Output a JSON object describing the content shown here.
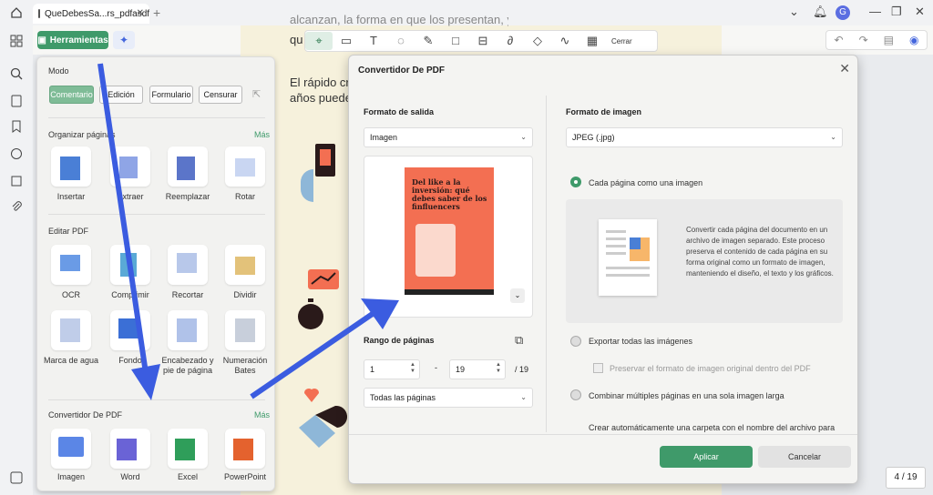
{
  "tab": {
    "title": "QueDebesSa...rs_pdfasdf"
  },
  "avatar_letter": "G",
  "toolbar": {
    "tools_label": "Herramientas",
    "close_label": "Cerrar"
  },
  "document": {
    "line0": "alcanzan, la forma en que los presentan, y la influencia (positiva o negativa)",
    "line1": "qu",
    "line2a": "El rápido cre",
    "line2b": "años puede"
  },
  "page_counter": "4 / 19",
  "tools_panel": {
    "mode_label": "Modo",
    "modes": [
      "Comentario",
      "Edición",
      "Formulario",
      "Censurar"
    ],
    "organize_label": "Organizar páginas",
    "more_label": "Más",
    "organize_items": [
      "Insertar",
      "Extraer",
      "Reemplazar",
      "Rotar"
    ],
    "edit_label": "Editar PDF",
    "edit_items": [
      "OCR",
      "Comprimir",
      "Recortar",
      "Dividir",
      "Marca de agua",
      "Fondo",
      "Encabezado y pie de página",
      "Numeración Bates"
    ],
    "convert_label": "Convertidor De PDF",
    "convert_items": [
      "Imagen",
      "Word",
      "Excel",
      "PowerPoint"
    ]
  },
  "dialog": {
    "title": "Convertidor De PDF",
    "output_format_label": "Formato de salida",
    "output_format_value": "Imagen",
    "image_format_label": "Formato de imagen",
    "image_format_value": "JPEG (.jpg)",
    "cover_title": "Del like a la inversión: qué debes saber de los finfluencers",
    "page_range_label": "Rango de páginas",
    "range_from": "1",
    "range_to": "19",
    "range_total": "/ 19",
    "range_dash": "-",
    "pages_select": "Todas las páginas",
    "option_each_page": "Cada página como una imagen",
    "option_each_desc": "Convertir cada página del documento en un archivo de imagen separado. Este proceso preserva el contenido de cada página en su forma original como un formato de imagen, manteniendo el diseño, el texto y los gráficos.",
    "option_export_all": "Exportar todas las imágenes",
    "option_preserve": "Preservar el formato de imagen original dentro del PDF",
    "option_combine": "Combinar múltiples páginas en una sola imagen larga",
    "option_folder": "Crear automáticamente una carpeta con el nombre del archivo para",
    "apply_label": "Aplicar",
    "cancel_label": "Cancelar"
  },
  "colors": {
    "accent": "#3f9a6a",
    "arrow": "#3b5ce0",
    "cover": "#f36f52"
  }
}
